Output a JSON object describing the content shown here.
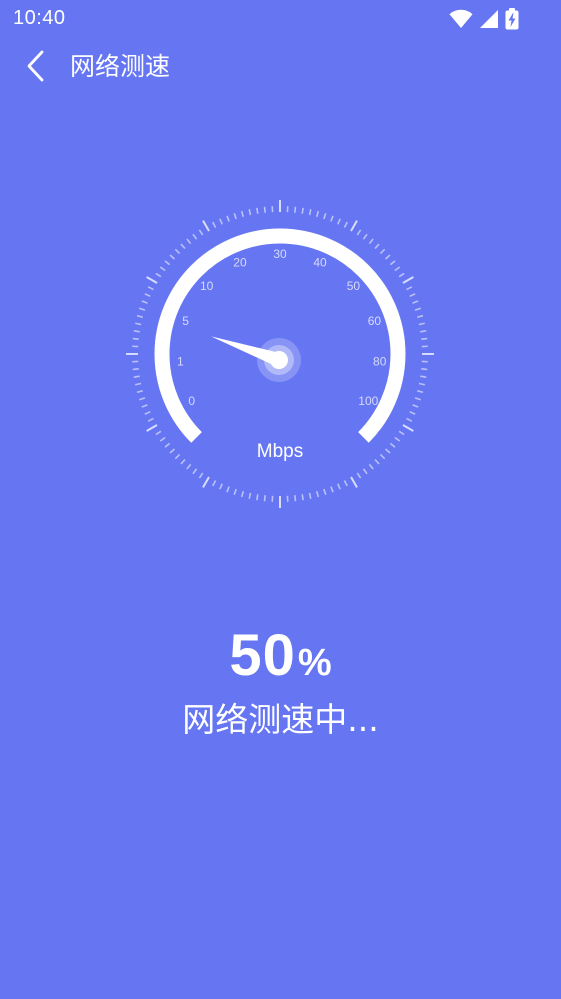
{
  "status_bar": {
    "time": "10:40",
    "icons": [
      "wifi-icon",
      "signal-icon",
      "battery-charging-icon"
    ]
  },
  "header": {
    "back_icon": "chevron-left-icon",
    "title": "网络测速"
  },
  "gauge": {
    "unit": "Mbps",
    "tick_labels": [
      "0",
      "1",
      "5",
      "10",
      "20",
      "30",
      "40",
      "50",
      "60",
      "80",
      "100"
    ],
    "needle_value": "5"
  },
  "progress": {
    "percent": 50,
    "value_text": "50",
    "symbol": "%"
  },
  "status_text": "网络测速中...",
  "colors": {
    "background": "#6676f2",
    "foreground": "#ffffff"
  }
}
